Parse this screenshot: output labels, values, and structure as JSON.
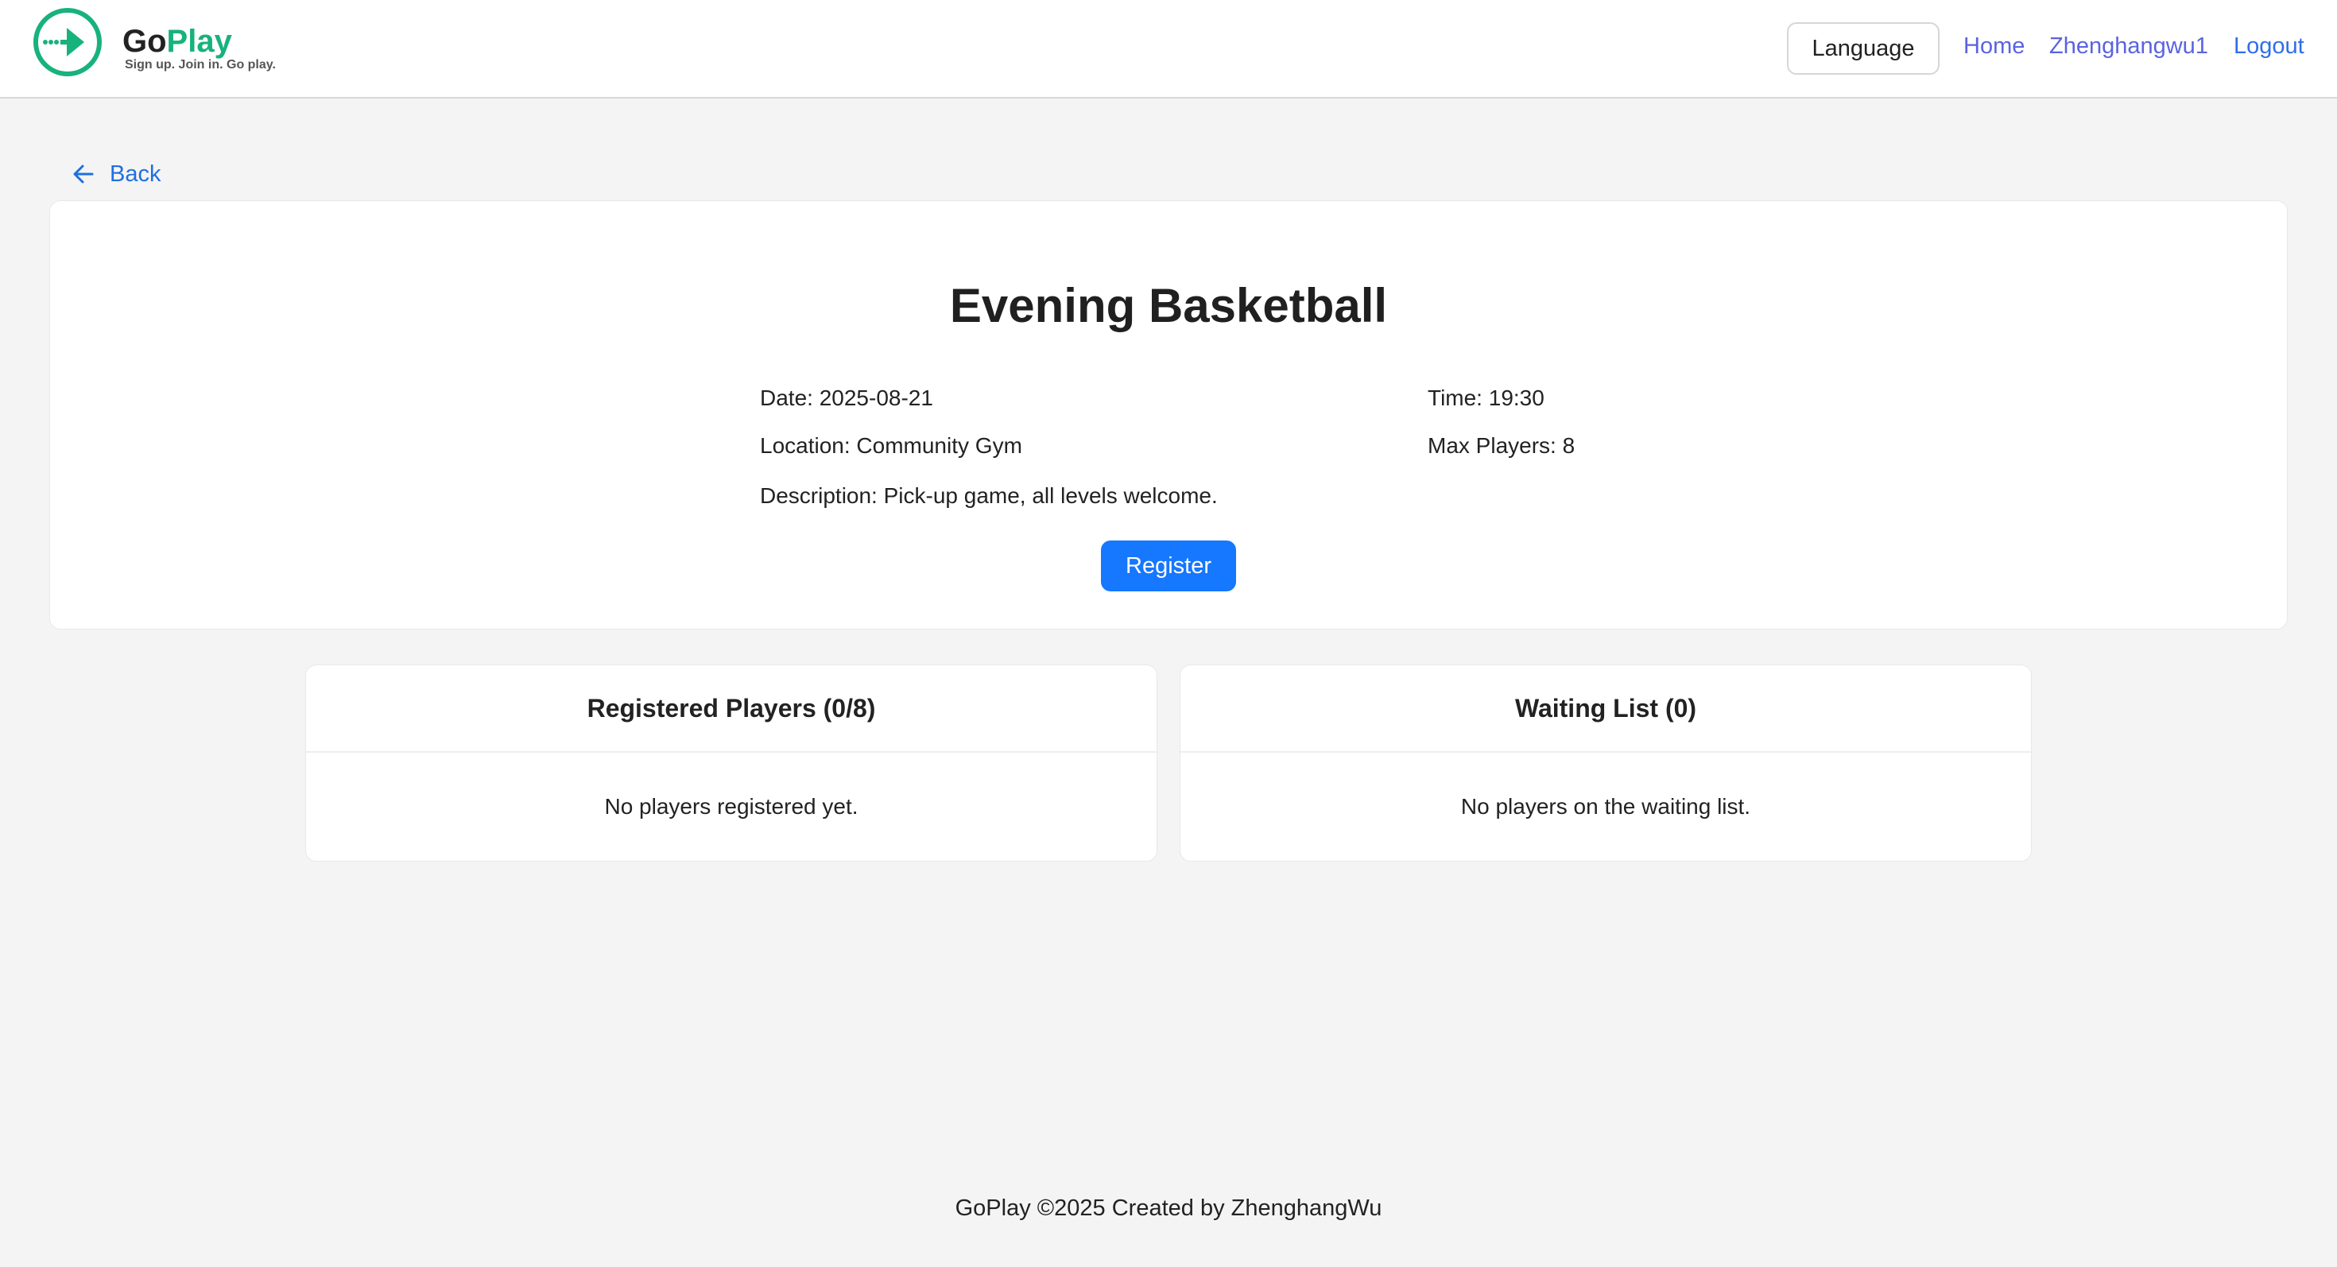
{
  "header": {
    "brand_go": "Go",
    "brand_play": "Play",
    "tagline": "Sign up. Join in. Go play.",
    "language_label": "Language",
    "nav": {
      "home": "Home",
      "user": "Zhenghangwu1",
      "logout": "Logout"
    }
  },
  "back_label": "Back",
  "event": {
    "title": "Evening Basketball",
    "date": "Date: 2025-08-21",
    "time": "Time: 19:30",
    "location": "Location: Community Gym",
    "max_players": "Max Players: 8",
    "description": "Description: Pick-up game, all levels welcome.",
    "register_label": "Register"
  },
  "registered": {
    "title": "Registered Players (0/8)",
    "empty": "No players registered yet."
  },
  "waiting": {
    "title": "Waiting List (0)",
    "empty": "No players on the waiting list."
  },
  "footer": "GoPlay ©2025 Created by ZhenghangWu",
  "colors": {
    "brand_green": "#18b27c",
    "primary_blue": "#1677ff",
    "nav_link": "#5a63e0",
    "background": "#f4f4f4"
  },
  "icons": {
    "logo": "play-arrow-circle-icon",
    "back": "arrow-left-icon"
  }
}
